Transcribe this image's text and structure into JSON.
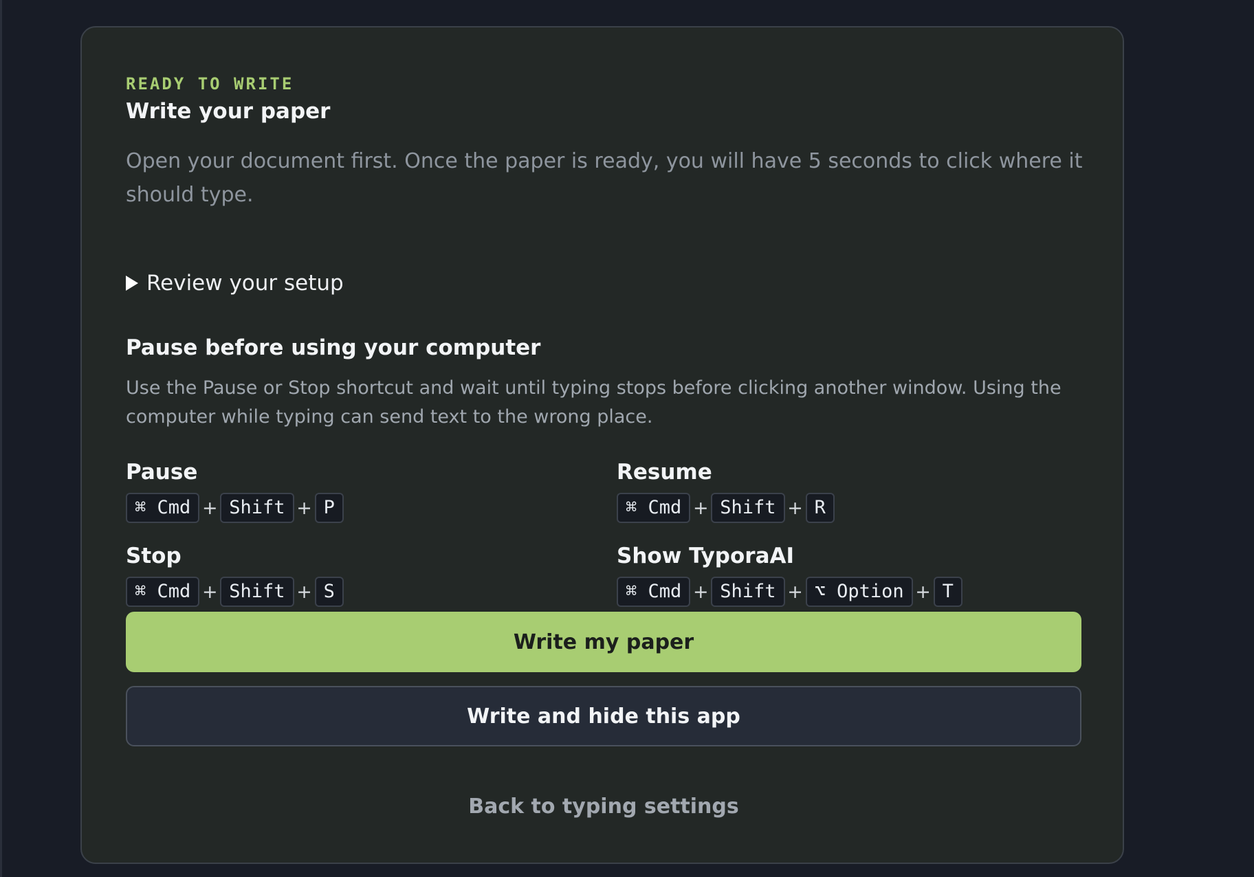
{
  "card": {
    "eyebrow": "READY TO WRITE",
    "title": "Write your paper",
    "intro": "Open your document first. Once the paper is ready, you will have 5 seconds to click where it should type.",
    "review_toggle": "Review your setup",
    "warning": {
      "title": "Pause before using your computer",
      "body": "Use the Pause or Stop shortcut and wait until typing stops before clicking another window. Using the computer while typing can send text to the wrong place."
    },
    "shortcuts": {
      "pause": {
        "label": "Pause",
        "keys": [
          "⌘ Cmd",
          "Shift",
          "P"
        ]
      },
      "resume": {
        "label": "Resume",
        "keys": [
          "⌘ Cmd",
          "Shift",
          "R"
        ]
      },
      "stop": {
        "label": "Stop",
        "keys": [
          "⌘ Cmd",
          "Shift",
          "S"
        ]
      },
      "show": {
        "label": "Show TyporaAI",
        "keys": [
          "⌘ Cmd",
          "Shift",
          "⌥ Option",
          "T"
        ]
      }
    },
    "plus": "+",
    "primary_button": "Write my paper",
    "secondary_button": "Write and hide this app",
    "back_link": "Back to typing settings"
  },
  "colors": {
    "accent": "#a8cd72",
    "background": "#181c26",
    "card": "#232826"
  }
}
